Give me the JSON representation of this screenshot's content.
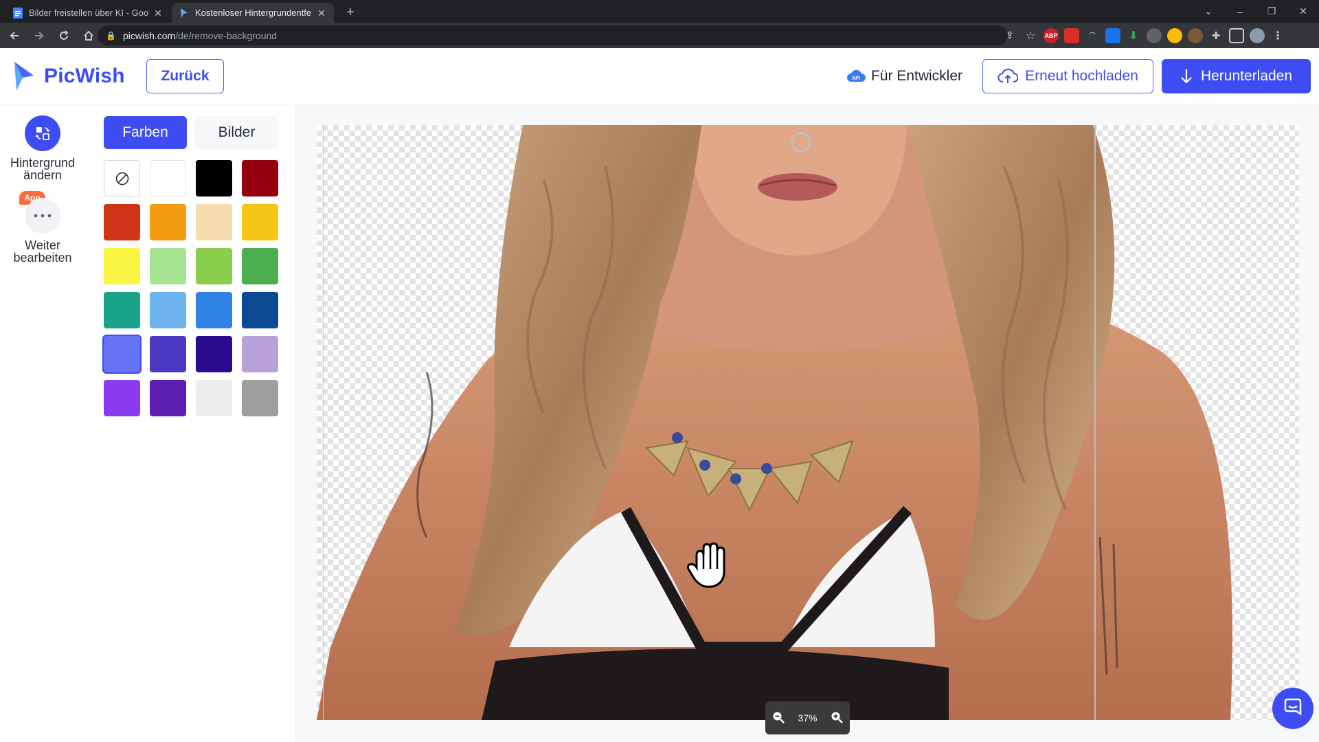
{
  "browser": {
    "tabs": [
      {
        "title": "Bilder freistellen über KI - Google",
        "active": false
      },
      {
        "title": "Kostenloser Hintergrundentferner",
        "active": true
      }
    ],
    "url_host": "picwish.com",
    "url_path": "/de/remove-background"
  },
  "header": {
    "logo_text": "PicWish",
    "back_label": "Zurück",
    "developer_label": "Für Entwickler",
    "api_badge": "API",
    "reupload_label": "Erneut hochladen",
    "download_label": "Herunterladen"
  },
  "rail": {
    "change_bg_label_1": "Hintergrund",
    "change_bg_label_2": "ändern",
    "app_badge": "App",
    "more_label_1": "Weiter",
    "more_label_2": "bearbeiten"
  },
  "panel": {
    "tab_colors": "Farben",
    "tab_images": "Bilder",
    "swatches": [
      "none",
      "#ffffff",
      "#000000",
      "#950010",
      "#d03317",
      "#f59c13",
      "#f7dbae",
      "#f5c518",
      "#faf542",
      "#a6e391",
      "#89cf4b",
      "#4dae4f",
      "#17a488",
      "#6db3f0",
      "#2e83e4",
      "#0b4a93",
      "#6872f6",
      "#4b3ac1",
      "#2a0b8e",
      "#b8a1d7",
      "#8a3bf0",
      "#5d1fb0",
      "#ececec",
      "#9e9e9e"
    ],
    "selected_index": 16
  },
  "canvas": {
    "zoom": "37%"
  },
  "colors": {
    "brand": "#3e4cf4"
  }
}
